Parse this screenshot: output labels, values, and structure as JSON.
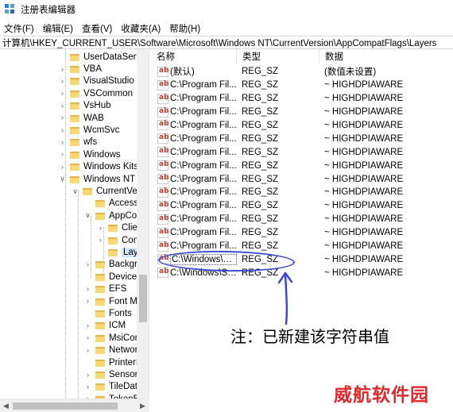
{
  "window": {
    "title": "注册表编辑器",
    "icon": "regedit-icon"
  },
  "menu": [
    "文件(F)",
    "编辑(E)",
    "查看(V)",
    "收藏夹(A)",
    "帮助(H)"
  ],
  "address": "计算机\\HKEY_CURRENT_USER\\Software\\Microsoft\\Windows NT\\CurrentVersion\\AppCompatFlags\\Layers",
  "tree": [
    {
      "label": "UserDataServi",
      "expander": "none"
    },
    {
      "label": "VBA",
      "expander": ">"
    },
    {
      "label": "VisualStudio",
      "expander": ">"
    },
    {
      "label": "VSCommon",
      "expander": ">"
    },
    {
      "label": "VsHub",
      "expander": ">"
    },
    {
      "label": "WAB",
      "expander": ">"
    },
    {
      "label": "WcmSvc",
      "expander": ">"
    },
    {
      "label": "wfs",
      "expander": ">"
    },
    {
      "label": "Windows",
      "expander": ">"
    },
    {
      "label": "Windows Kits",
      "expander": ">"
    },
    {
      "label": "Windows NT",
      "expander": "v"
    },
    {
      "label": "CurrentVer",
      "expander": "v"
    },
    {
      "label": "Accessil",
      "expander": "none"
    },
    {
      "label": "AppCor",
      "expander": "v"
    },
    {
      "label": "Clier",
      "expander": ">"
    },
    {
      "label": "Com",
      "expander": ">"
    },
    {
      "label": "Laye",
      "expander": "none"
    },
    {
      "label": "Backgro",
      "expander": ">"
    },
    {
      "label": "Devices",
      "expander": "none"
    },
    {
      "label": "EFS",
      "expander": ">"
    },
    {
      "label": "Font Ma",
      "expander": ">"
    },
    {
      "label": "Fonts",
      "expander": "none"
    },
    {
      "label": "ICM",
      "expander": ">"
    },
    {
      "label": "MsiCorr",
      "expander": ">"
    },
    {
      "label": "Networ",
      "expander": ">"
    },
    {
      "label": "PrinterP",
      "expander": "none"
    },
    {
      "label": "Sensor",
      "expander": ">"
    },
    {
      "label": "TileData",
      "expander": ">"
    },
    {
      "label": "TokenB",
      "expander": ">"
    }
  ],
  "columns": {
    "name": "名称",
    "type": "类型",
    "data": "数据"
  },
  "values": [
    {
      "name": "(默认)",
      "type": "REG_SZ",
      "data": "(数值未设置)"
    },
    {
      "name": "C:\\Program Fil...",
      "type": "REG_SZ",
      "data": "~ HIGHDPIAWARE"
    },
    {
      "name": "C:\\Program Fil...",
      "type": "REG_SZ",
      "data": "~ HIGHDPIAWARE"
    },
    {
      "name": "C:\\Program Fil...",
      "type": "REG_SZ",
      "data": "~ HIGHDPIAWARE"
    },
    {
      "name": "C:\\Program Fil...",
      "type": "REG_SZ",
      "data": "~ HIGHDPIAWARE"
    },
    {
      "name": "C:\\Program Fil...",
      "type": "REG_SZ",
      "data": "~ HIGHDPIAWARE"
    },
    {
      "name": "C:\\Program Fil...",
      "type": "REG_SZ",
      "data": "~ HIGHDPIAWARE"
    },
    {
      "name": "C:\\Program Fil...",
      "type": "REG_SZ",
      "data": "~ HIGHDPIAWARE"
    },
    {
      "name": "C:\\Program Fil...",
      "type": "REG_SZ",
      "data": "~ HIGHDPIAWARE"
    },
    {
      "name": "C:\\Program Fil...",
      "type": "REG_SZ",
      "data": "~ HIGHDPIAWARE"
    },
    {
      "name": "C:\\Program Fil...",
      "type": "REG_SZ",
      "data": "~ HIGHDPIAWARE"
    },
    {
      "name": "C:\\Program Fil...",
      "type": "REG_SZ",
      "data": "~ HIGHDPIAWARE"
    },
    {
      "name": "C:\\Program Fil...",
      "type": "REG_SZ",
      "data": "~ HIGHDPIAWARE"
    },
    {
      "name": "C:\\Program Fil...",
      "type": "REG_SZ",
      "data": "~ HIGHDPIAWARE"
    },
    {
      "name": "C:\\Windows\\Sy...",
      "type": "REG_SZ",
      "data": "~ HIGHDPIAWARE"
    },
    {
      "name": "C:\\Windows\\Sy...",
      "type": "REG_SZ",
      "data": "~ HIGHDPIAWARE"
    }
  ],
  "annotation": {
    "note": "注：已新建该字符串值",
    "color": "#3c4ad3"
  },
  "watermark": {
    "text": "威航软件园",
    "color": "#e0292d"
  }
}
